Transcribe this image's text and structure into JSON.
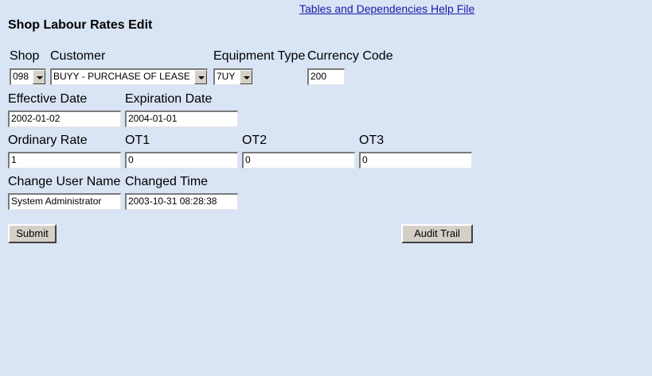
{
  "header": {
    "help_link": "Tables and Dependencies Help File",
    "title": "Shop Labour Rates Edit"
  },
  "labels": {
    "shop": "Shop",
    "customer": "Customer",
    "equipment_type": "Equipment Type",
    "currency_code": "Currency Code",
    "effective_date": "Effective Date",
    "expiration_date": "Expiration Date",
    "ordinary_rate": "Ordinary Rate",
    "ot1": "OT1",
    "ot2": "OT2",
    "ot3": "OT3",
    "change_user_name": "Change User Name",
    "changed_time": "Changed Time"
  },
  "fields": {
    "shop": "098",
    "customer": "BUYY - PURCHASE OF LEASE",
    "equipment_type": "7UY",
    "currency_code": "200",
    "effective_date": "2002-01-02",
    "expiration_date": "2004-01-01",
    "ordinary_rate": "1",
    "ot1": "0",
    "ot2": "0",
    "ot3": "0",
    "change_user_name": "System Administrator",
    "changed_time": "2003-10-31 08:28:38"
  },
  "buttons": {
    "submit": "Submit",
    "audit_trail": "Audit Trail"
  }
}
